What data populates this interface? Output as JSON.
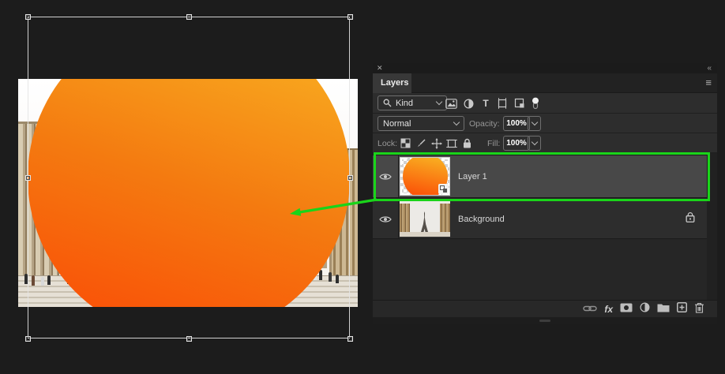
{
  "annotation": {
    "color": "#1ad41a"
  },
  "gradient": {
    "top": "#f9b222",
    "bottom": "#fa4e07"
  },
  "icons": {
    "close": "✕",
    "collapse": "«",
    "panel_menu": "≡",
    "type_glyph": "T",
    "fx_glyph": "fx",
    "search": "magnifier-css-shape",
    "chevron_down": "css-shape"
  },
  "panel": {
    "tab_label": "Layers",
    "filter": {
      "kind_value": "Kind"
    },
    "blend": {
      "mode_value": "Normal",
      "opacity_label": "Opacity:",
      "opacity_value": "100%"
    },
    "lock_row": {
      "lock_label": "Lock:",
      "fill_label": "Fill:",
      "fill_value": "100%"
    },
    "layers": [
      {
        "name": "Layer 1",
        "selected": true,
        "visible": true,
        "smart_object": true
      },
      {
        "name": "Background",
        "selected": false,
        "visible": true,
        "locked": true
      }
    ]
  }
}
